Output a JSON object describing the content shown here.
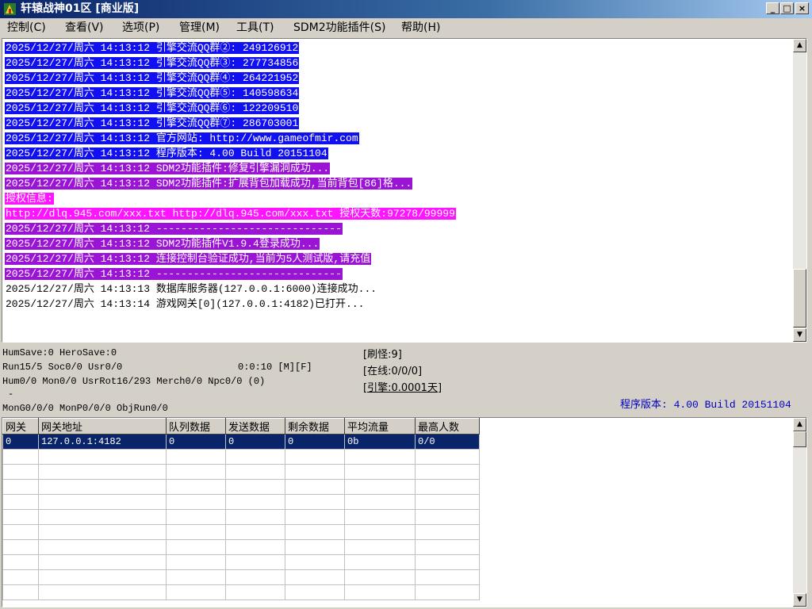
{
  "window": {
    "title": "轩辕战神01区 [商业版]",
    "buttons": [
      "_",
      "□",
      "×"
    ]
  },
  "menu": [
    {
      "label": "控制(C)"
    },
    {
      "label": "查看(V)"
    },
    {
      "label": "选项(P)"
    },
    {
      "label": "管理(M)"
    },
    {
      "label": "工具(T)"
    },
    {
      "label": "SDM2功能插件(S)"
    },
    {
      "label": "帮助(H)"
    }
  ],
  "log": {
    "lines": [
      {
        "text": "2025/12/27/周六 14:13:12 引擎交流QQ群②: 249126912",
        "bg": "#1010f0",
        "color": "#ffffff"
      },
      {
        "text": "2025/12/27/周六 14:13:12 引擎交流QQ群③: 277734856",
        "bg": "#1010f0",
        "color": "#ffffff"
      },
      {
        "text": "2025/12/27/周六 14:13:12 引擎交流QQ群④: 264221952",
        "bg": "#1010f0",
        "color": "#ffffff"
      },
      {
        "text": "2025/12/27/周六 14:13:12 引擎交流QQ群⑤: 140598634",
        "bg": "#1010f0",
        "color": "#ffffff"
      },
      {
        "text": "2025/12/27/周六 14:13:12 引擎交流QQ群⑥: 122209510",
        "bg": "#1010f0",
        "color": "#ffffff"
      },
      {
        "text": "2025/12/27/周六 14:13:12 引擎交流QQ群⑦: 286703001",
        "bg": "#1010f0",
        "color": "#ffffff"
      },
      {
        "text": "2025/12/27/周六 14:13:12 官方网站: http://www.gameofmir.com",
        "bg": "#1010f0",
        "color": "#ffffff"
      },
      {
        "text": "2025/12/27/周六 14:13:12 程序版本: 4.00 Build 20151104",
        "bg": "#1010f0",
        "color": "#ffffff"
      },
      {
        "text": "2025/12/27/周六 14:13:12 SDM2功能插件:修复引擎漏洞成功...",
        "bg": "#9b14d6",
        "color": "#ffffff"
      },
      {
        "text": "2025/12/27/周六 14:13:12 SDM2功能插件:扩展背包加载成功,当前背包[86]格...",
        "bg": "#9b14d6",
        "color": "#ffffff"
      },
      {
        "text": "授权信息:",
        "bg": "#ff14ff",
        "color": "#ffffff"
      },
      {
        "text": "http://dlq.945.com/xxx.txt http://dlq.945.com/xxx.txt 授权天数:97278/99999",
        "bg": "#ff14ff",
        "color": "#ffffff"
      },
      {
        "text": "2025/12/27/周六 14:13:12 ------------------------------",
        "bg": "#9b14d6",
        "color": "#ffffff"
      },
      {
        "text": "2025/12/27/周六 14:13:12 SDM2功能插件V1.9.4登录成功...",
        "bg": "#9b14d6",
        "color": "#ffffff"
      },
      {
        "text": "2025/12/27/周六 14:13:12 连接控制台验证成功,当前为5人测试版,请充值",
        "bg": "#9b14d6",
        "color": "#ffffff"
      },
      {
        "text": "2025/12/27/周六 14:13:12 ------------------------------",
        "bg": "#9b14d6",
        "color": "#ffffff"
      },
      {
        "text": "2025/12/27/周六 14:13:13 数据库服务器(127.0.0.1:6000)连接成功...",
        "bg": "transparent",
        "color": "#000000"
      },
      {
        "text": "2025/12/27/周六 14:13:14 游戏网关[0](127.0.0.1:4182)已打开...",
        "bg": "transparent",
        "color": "#000000"
      }
    ]
  },
  "status": {
    "line1": "HumSave:0 HeroSave:0",
    "line2a": "Run15/5 Soc0/0 Usr0/0",
    "line2b": "0:0:10 [M][F]",
    "line3": "Hum0/0 Mon0/0 UsrRot16/293 Merch0/0 Npc0/0 (0)",
    "line4": "-",
    "line5": "MonG0/0/0 MonP0/0/0 ObjRun0/0",
    "refresh": "[刷怪:9]",
    "online": "[在线:0/0/0]",
    "engine": "[引擎:0.0001天]",
    "version": "程序版本: 4.00 Build 20151104"
  },
  "grid": {
    "columns": [
      "网关",
      "网关地址",
      "队列数据",
      "发送数据",
      "剩余数据",
      "平均流量",
      "最高人数"
    ],
    "rows": [
      [
        "0",
        "127.0.0.1:4182",
        "0",
        "0",
        "0",
        "0b",
        "0/0"
      ]
    ],
    "empty_rows": 10
  },
  "colors": {
    "blue_log": "#1010f0",
    "purple_log": "#9b14d6",
    "magenta_log": "#ff14ff",
    "selection": "#0a246a",
    "version_text": "#0000c0"
  }
}
